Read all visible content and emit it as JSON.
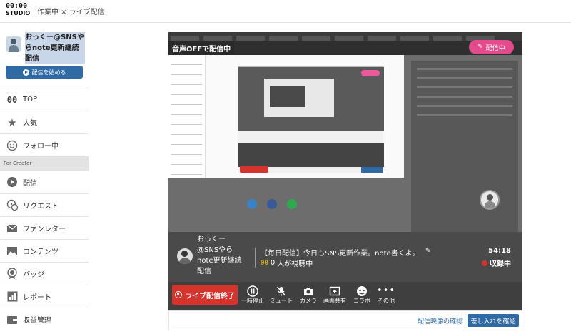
{
  "header": {
    "logo_line1": "00:00",
    "logo_line2": "STUDIO",
    "title": "作業中 × ライブ配信"
  },
  "profile": {
    "name": "おっくー@SNSやらnote更新継続配信",
    "start_button": "配信を始める"
  },
  "nav": {
    "items": [
      {
        "label": "TOP",
        "icon": "logo-00-icon"
      },
      {
        "label": "人気",
        "icon": "star-icon"
      },
      {
        "label": "フォロー中",
        "icon": "smile-icon"
      }
    ],
    "section": "For Creator",
    "creator_items": [
      {
        "label": "配信",
        "icon": "play-icon"
      },
      {
        "label": "リクエスト",
        "icon": "request-icon"
      },
      {
        "label": "ファンレター",
        "icon": "mail-icon"
      },
      {
        "label": "コンテンツ",
        "icon": "image-icon"
      },
      {
        "label": "バッジ",
        "icon": "badge-icon"
      },
      {
        "label": "レポート",
        "icon": "report-icon"
      },
      {
        "label": "収益管理",
        "icon": "wallet-icon"
      }
    ]
  },
  "stream": {
    "mute_overlay": "音声OFFで配信中",
    "live_badge": "配信中",
    "streamer_name": "おっくー@SNSやらnote更新継続配信",
    "stream_title": "【毎日配信】今日もSNS更新作業。note書くよ。",
    "viewer_count": "0",
    "viewer_text": "人が視聴中",
    "elapsed_time": "54:18",
    "recording_label": "収録中"
  },
  "controls": {
    "end_button": "ライブ配信終了",
    "buttons": [
      {
        "label": "一時停止",
        "icon": "pause-icon"
      },
      {
        "label": "ミュート",
        "icon": "mic-off-icon"
      },
      {
        "label": "カメラ",
        "icon": "camera-icon"
      },
      {
        "label": "画面共有",
        "icon": "screen-share-icon"
      },
      {
        "label": "コラボ",
        "icon": "collab-icon"
      },
      {
        "label": "その他",
        "icon": "more-icon"
      }
    ]
  },
  "footer": {
    "check_video_link": "配信映像の確認",
    "check_gift_button": "差し入れを確認"
  },
  "colors": {
    "accent_blue": "#2f6aa4",
    "live_pink": "#e44b8c",
    "end_red": "#d4342b"
  }
}
